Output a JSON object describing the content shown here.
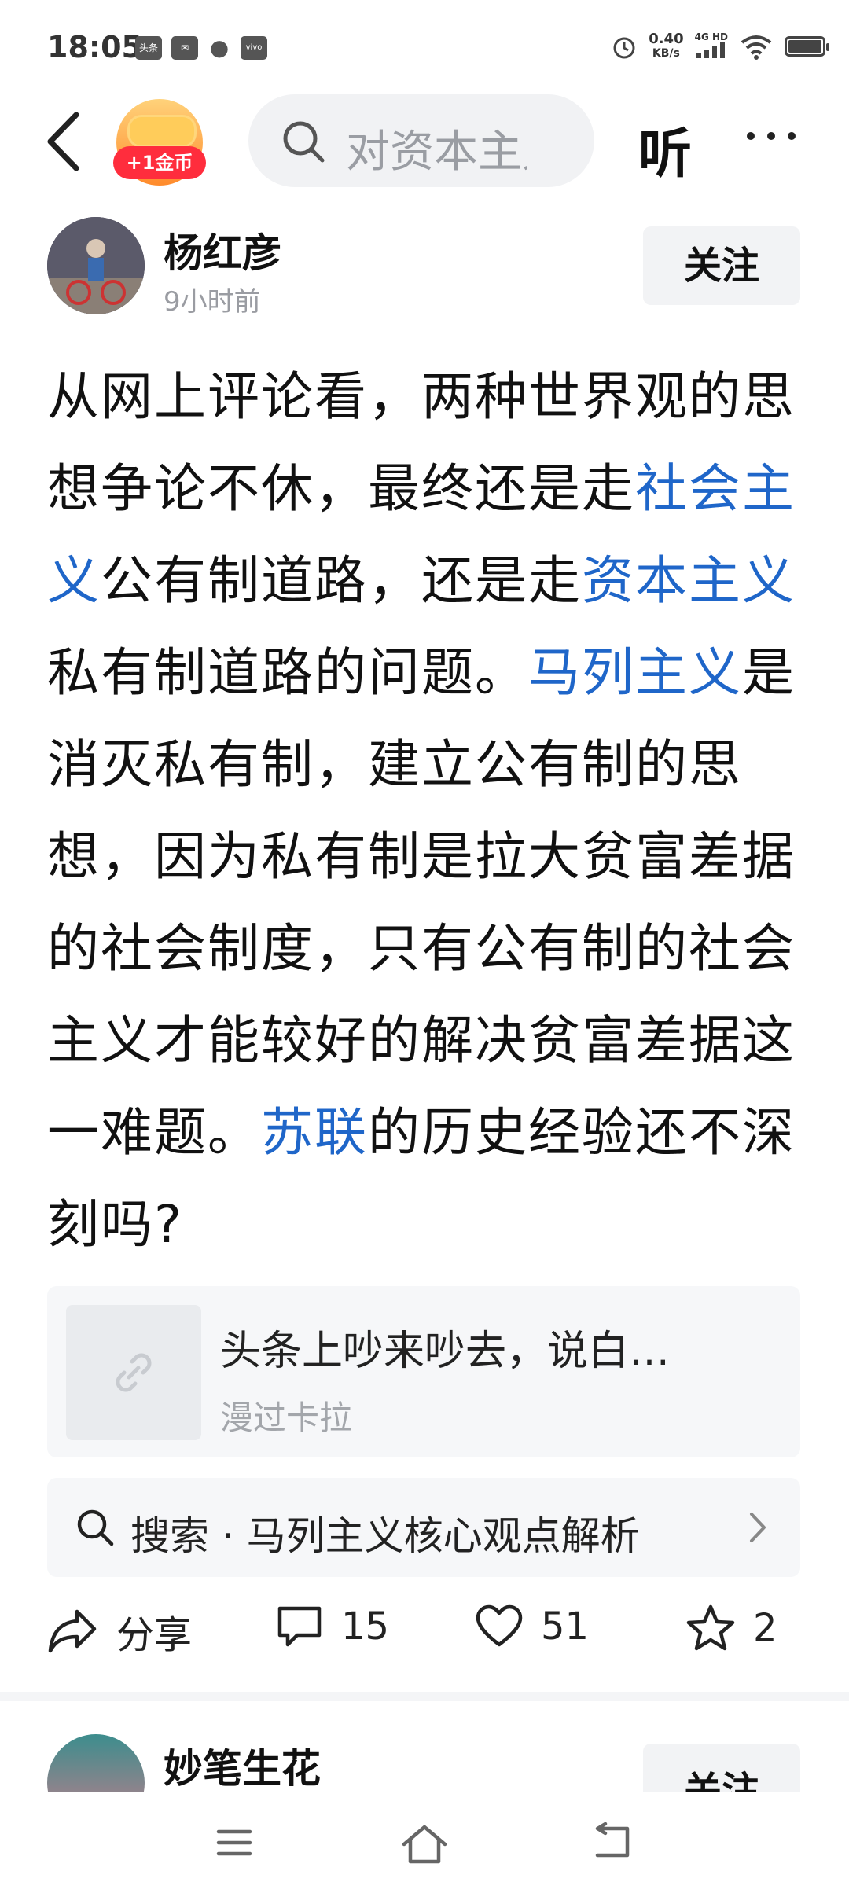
{
  "status_bar": {
    "time": "18:05",
    "icons": [
      "toutiao-icon",
      "message-icon",
      "wechat-icon",
      "vivo-icon"
    ],
    "speed_value": "0.40",
    "speed_unit": "KB/s",
    "network": "4G HD",
    "alarm_icon": "alarm-icon",
    "wifi_icon": "wifi-icon",
    "battery_icon": "battery-icon"
  },
  "nav": {
    "back_icon": "back-chevron-icon",
    "coin_badge": "+1金币",
    "search_placeholder": "对资本主义",
    "listen": "听",
    "more_icon": "more-dots-icon"
  },
  "post": {
    "author": "杨红彦",
    "time_ago": "9小时前",
    "follow": "关注",
    "segments": [
      {
        "text": "从网上评论看，两种世界观的思想争论不休，最终还是走",
        "link": false
      },
      {
        "text": "社会主义",
        "link": true
      },
      {
        "text": "公有制道路，还是走",
        "link": false
      },
      {
        "text": "资本主义",
        "link": true
      },
      {
        "text": "私有制道路的问题。",
        "link": false
      },
      {
        "text": "马列主义",
        "link": true
      },
      {
        "text": "是消灭私有制，建立公有制的思想，因为私有制是拉大贫富差据的社会制度，只有公有制的社会主义才能较好的解决贫富差据这一难题。",
        "link": false
      },
      {
        "text": "苏联",
        "link": true
      },
      {
        "text": "的历史经验还不深刻吗?",
        "link": false
      }
    ],
    "link_card": {
      "title": "头条上吵来吵去，说白…",
      "source": "漫过卡拉"
    },
    "related_search": "搜索 · 马列主义核心观点解析",
    "actions": {
      "share": "分享",
      "comments": "15",
      "likes": "51",
      "favorites": "2"
    }
  },
  "next_post": {
    "author": "妙笔生花",
    "follow": "关注"
  },
  "colors": {
    "link_blue": "#1f66c9",
    "badge_red": "#ff2d3d"
  }
}
